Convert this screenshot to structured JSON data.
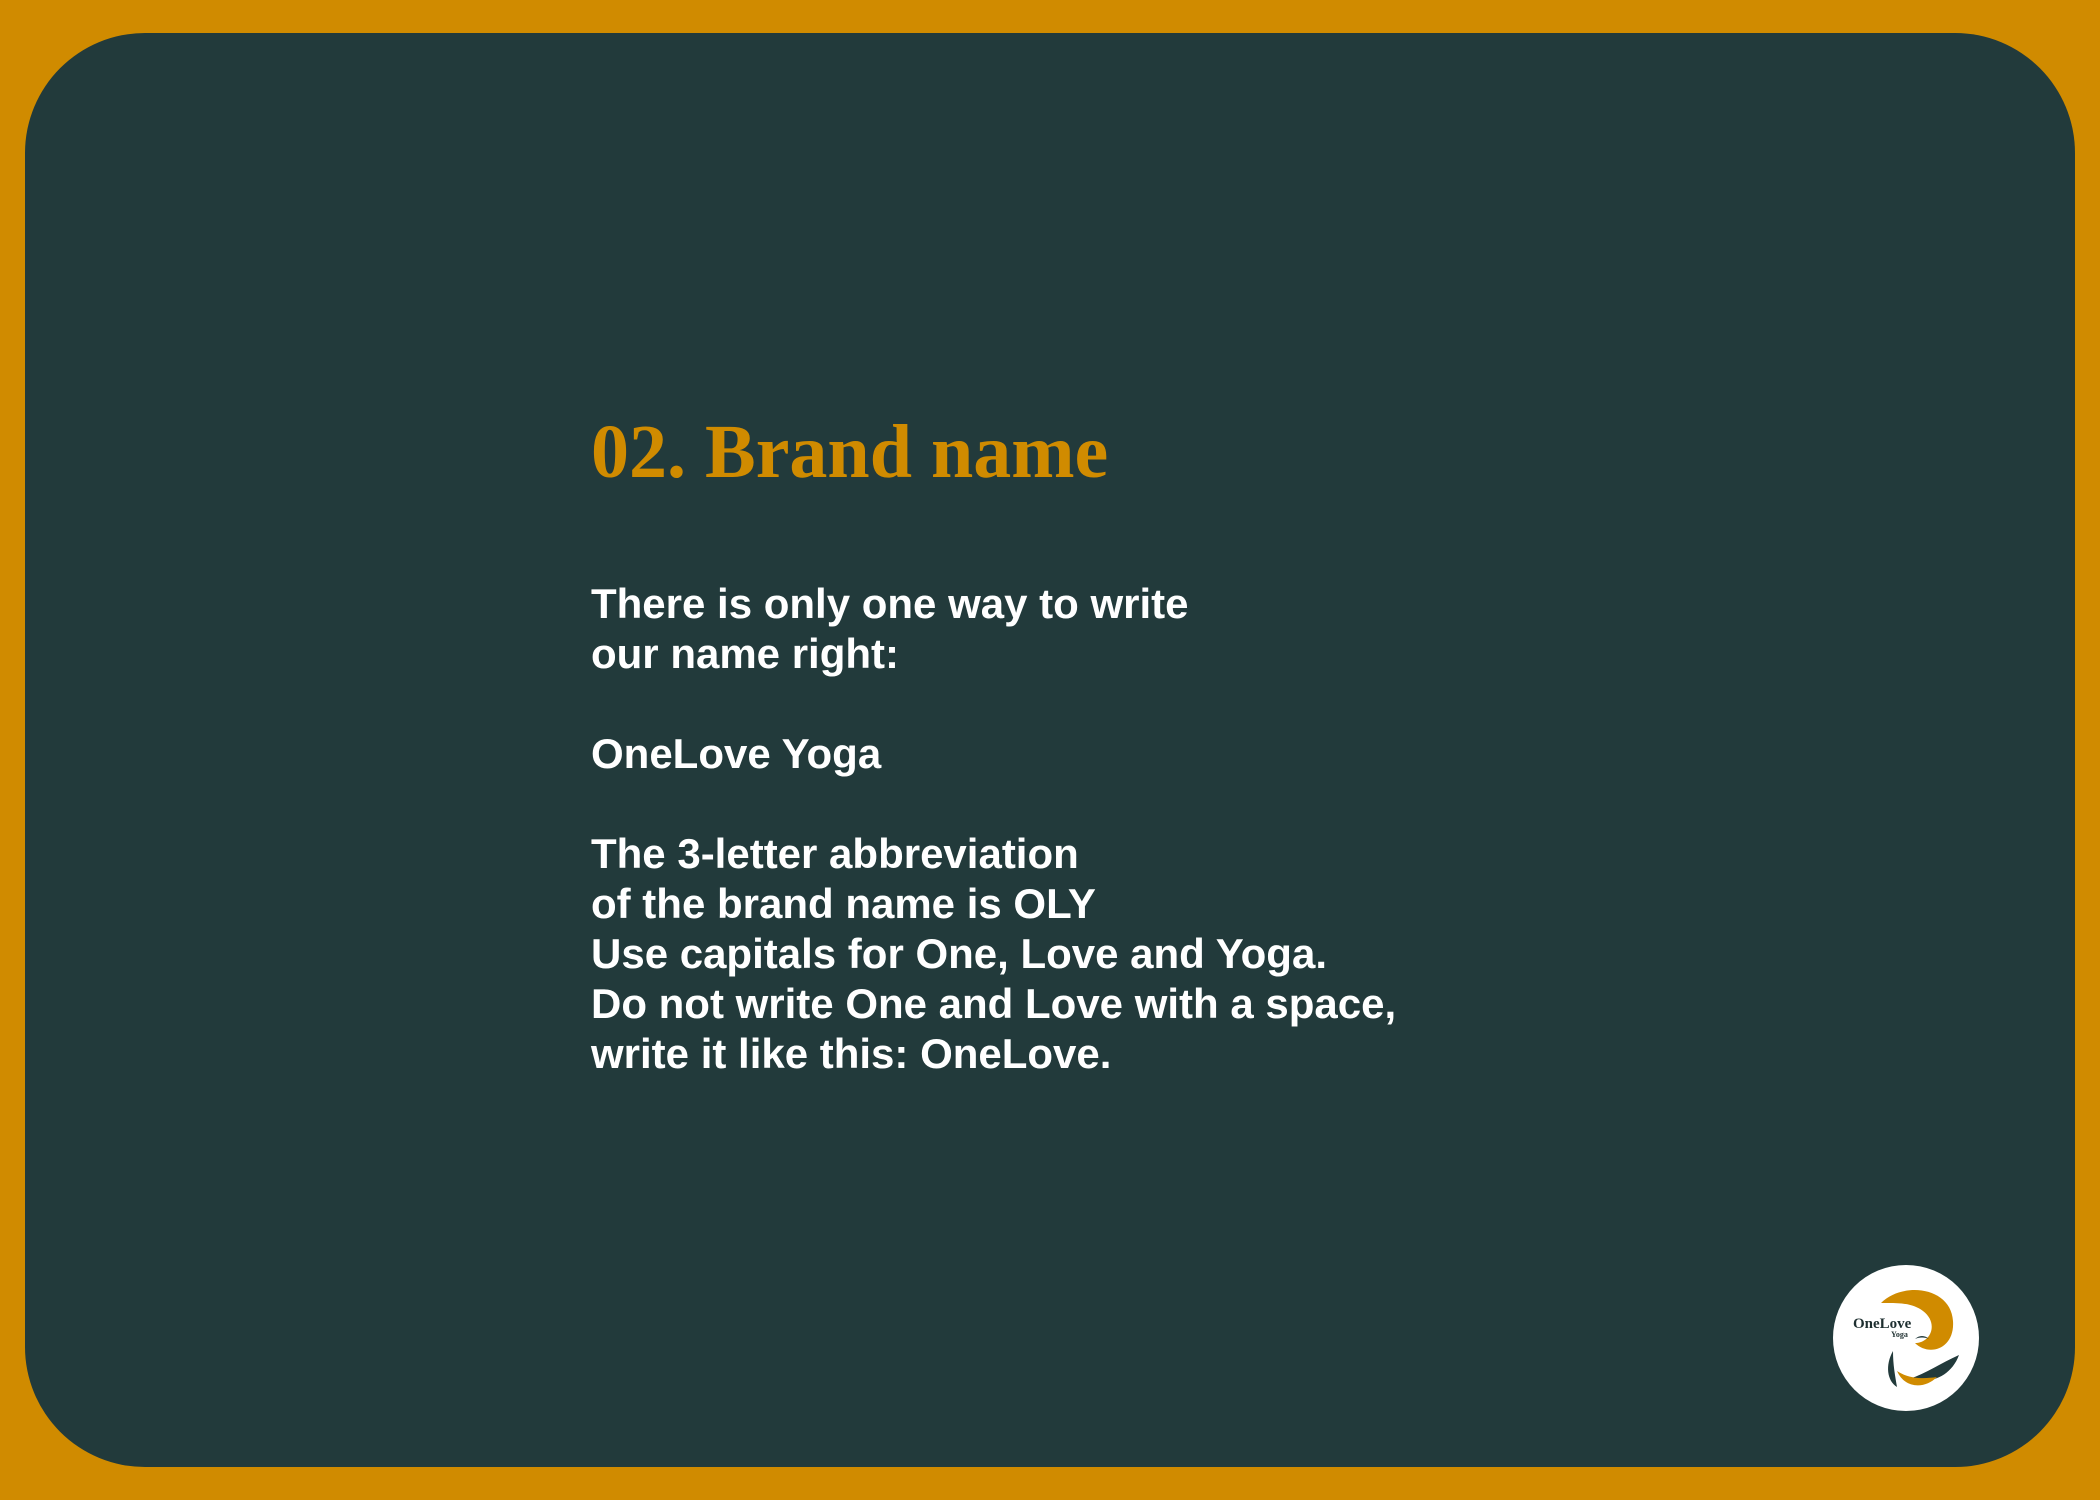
{
  "slide": {
    "title": "02. Brand name",
    "intro": [
      "There is only one way to write",
      "our name right:"
    ],
    "brand": "OneLove Yoga",
    "rules": [
      "The 3-letter abbreviation",
      "of the brand name is OLY",
      "Use capitals for One, Love and Yoga.",
      "Do not write One and Love with a space,",
      "write it like this: OneLove."
    ]
  },
  "logo": {
    "text": "OneLove",
    "subtext": "Yoga",
    "icon": "swirl-logo-icon"
  },
  "colors": {
    "frame": "#d08b00",
    "background": "#223a3b",
    "title": "#d08b00",
    "text": "#ffffff"
  }
}
